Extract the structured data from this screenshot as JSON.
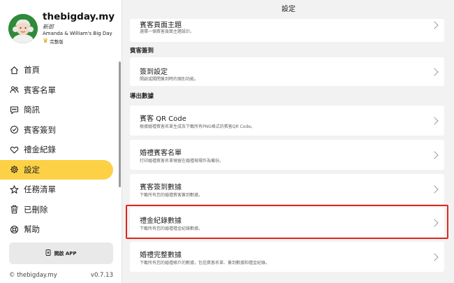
{
  "sidebar": {
    "site_name": "thebigday.my",
    "role": "新郎",
    "couple": "Amanda & William's Big Day",
    "plan": "完整版",
    "items": [
      {
        "label": "首頁",
        "icon": "home-icon"
      },
      {
        "label": "賓客名單",
        "icon": "guests-icon"
      },
      {
        "label": "簡訊",
        "icon": "message-icon"
      },
      {
        "label": "賓客簽到",
        "icon": "check-badge-icon"
      },
      {
        "label": "禮金紀錄",
        "icon": "heart-icon"
      },
      {
        "label": "設定",
        "icon": "gear-icon",
        "active": true
      },
      {
        "label": "任務清單",
        "icon": "task-icon"
      },
      {
        "label": "已刪除",
        "icon": "trash-icon"
      },
      {
        "label": "幫助",
        "icon": "help-icon"
      }
    ],
    "open_app": "開啟 APP",
    "copyright": "© thebigday.my",
    "version": "v0.7.13"
  },
  "main": {
    "title": "設定",
    "top_card": {
      "title": "賓客頁面主題",
      "desc": "選擇一個賓客頁面主題設計。"
    },
    "sections": [
      {
        "heading": "賓客簽到",
        "cards": [
          {
            "title": "簽到設定",
            "desc": "開啟或關閉簽到時的個別功能。"
          }
        ]
      },
      {
        "heading": "導出數據",
        "cards": [
          {
            "title": "賓客 QR Code",
            "desc": "根據婚禮賓客名單生成及下載所有PNG格式的賓客QR Code。"
          },
          {
            "title": "婚禮賓客名單",
            "desc": "打印婚禮賓客名單預留在婚禮現場作為備份。"
          },
          {
            "title": "賓客簽到數據",
            "desc": "下載所有您的婚禮賓客簽到數據。"
          },
          {
            "title": "禮金紀錄數據",
            "desc": "下載所有您的婚禮禮金紀錄數據。"
          },
          {
            "title": "婚禮完整數據",
            "desc": "下載所有您的婚禮帳戶的數據，包括賓客名單、簽到數據和禮金紀錄。"
          }
        ]
      }
    ]
  },
  "colors": {
    "accent": "#fcd146",
    "highlight": "#e0261e"
  }
}
